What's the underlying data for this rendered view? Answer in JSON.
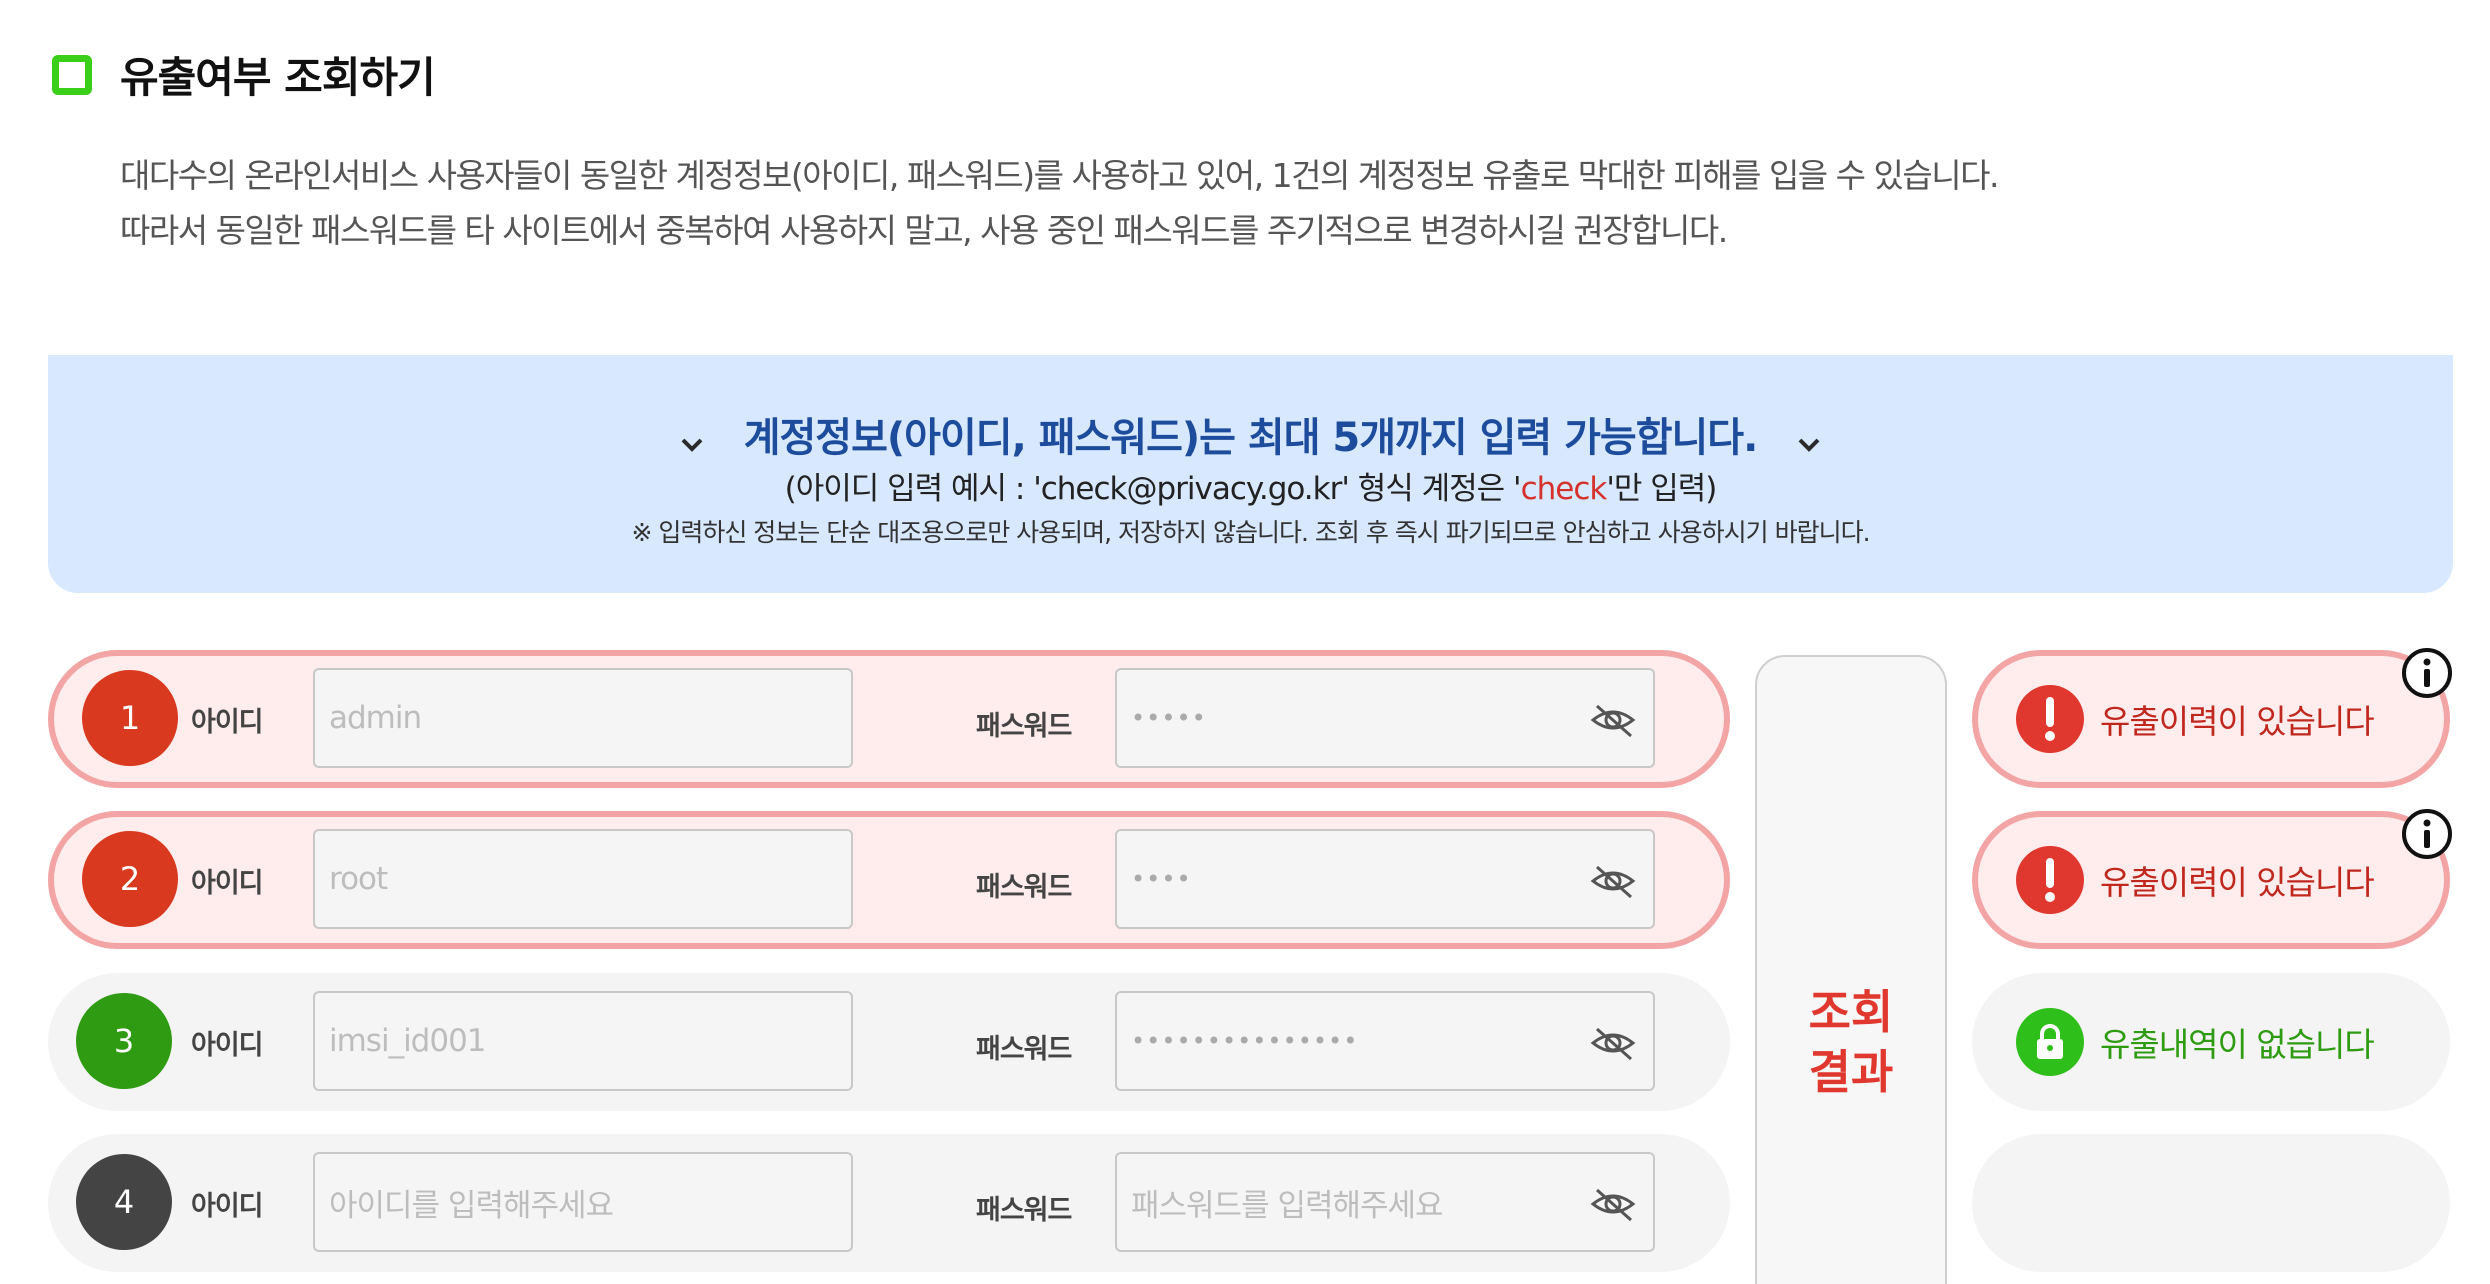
{
  "title": "유출여부 조회하기",
  "description": [
    "대다수의 온라인서비스 사용자들이 동일한 계정정보(아이디, 패스워드)를 사용하고 있어, 1건의 계정정보 유출로 막대한 피해를 입을 수 있습니다.",
    "따라서 동일한 패스워드를 타 사이트에서 중복하여 사용하지 말고, 사용 중인 패스워드를 주기적으로 변경하시길 권장합니다."
  ],
  "banner": {
    "heading": "계정정보(아이디, 패스워드)는 최대 5개까지 입력 가능합니다.",
    "example_prefix": "(아이디 입력 예시 : 'check@privacy.go.kr' 형식 계정은 '",
    "example_highlight": "check",
    "example_suffix": "'만 입력)",
    "note": "※ 입력하신 정보는 단순 대조용으로만 사용되며, 저장하지 않습니다. 조회 후 즉시 파기되므로 안심하고 사용하시기 바랍니다."
  },
  "labels": {
    "id": "아이디",
    "password": "패스워드"
  },
  "rows": [
    {
      "num": "1",
      "id_value": "admin",
      "pw_mask": "•••••",
      "color": "#d9391f",
      "status": "leak"
    },
    {
      "num": "2",
      "id_value": "root",
      "pw_mask": "••••",
      "color": "#d9391f",
      "status": "leak"
    },
    {
      "num": "3",
      "id_value": "imsi_id001",
      "pw_mask": "•••••••••••••••",
      "color": "#2e9b12",
      "status": "safe"
    },
    {
      "num": "4",
      "id_placeholder": "아이디를 입력해주세요",
      "pw_placeholder": "패스워드를 입력해주세요",
      "color": "#444444",
      "status": "empty"
    }
  ],
  "result_label_line1": "조회",
  "result_label_line2": "결과",
  "results": [
    {
      "text": "유출이력이 있습니다",
      "status": "leak",
      "color": "#c0281e"
    },
    {
      "text": "유출이력이 있습니다",
      "status": "leak",
      "color": "#c0281e"
    },
    {
      "text": "유출내역이 없습니다",
      "status": "safe",
      "color": "#2e9b12"
    },
    {
      "text": "",
      "status": "empty"
    }
  ],
  "colors": {
    "brand_green": "#3bcf1a",
    "banner_bg": "#d7e8ff",
    "banner_heading": "#1d4c9c",
    "leak_red": "#e0382e",
    "leak_border": "#f3a4a4",
    "safe_green": "#2e9b12"
  },
  "icons": {
    "title": "checkbox-square-icon",
    "banner": "chevron-down-icon",
    "eye": "eye-slash-icon",
    "leak": "exclamation-circle-icon",
    "safe": "lock-icon",
    "info": "info-circle-icon"
  }
}
